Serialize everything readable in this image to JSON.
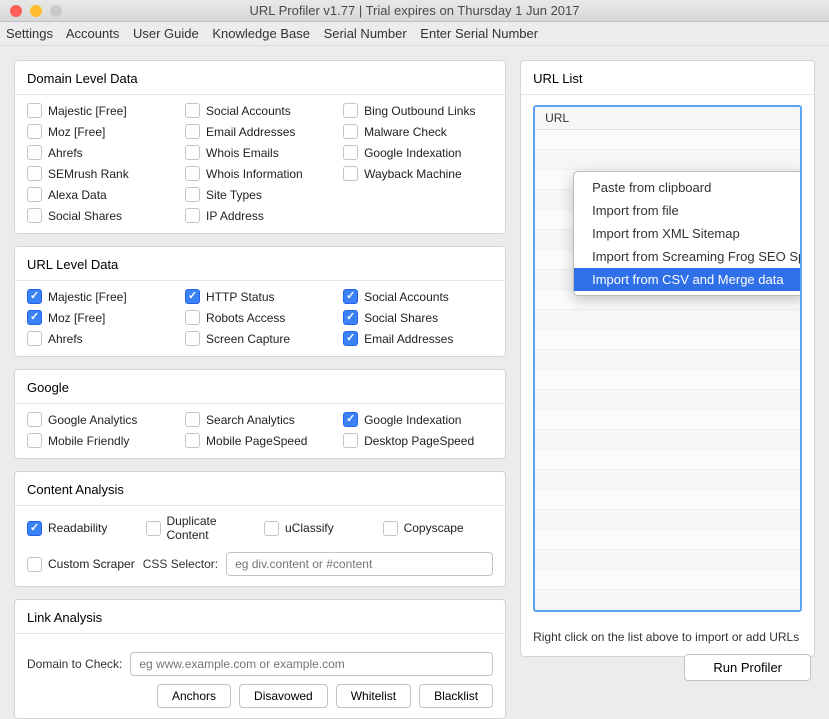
{
  "titlebar": {
    "title": "URL Profiler v1.77 | Trial expires on Thursday 1 Jun 2017"
  },
  "menubar": {
    "items": [
      "Settings",
      "Accounts",
      "User Guide",
      "Knowledge Base",
      "Serial Number",
      "Enter Serial Number"
    ]
  },
  "panels": {
    "domain": {
      "title": "Domain Level Data",
      "items": [
        {
          "label": "Majestic [Free]",
          "checked": false
        },
        {
          "label": "Social Accounts",
          "checked": false
        },
        {
          "label": "Bing Outbound Links",
          "checked": false
        },
        {
          "label": "Moz [Free]",
          "checked": false
        },
        {
          "label": "Email Addresses",
          "checked": false
        },
        {
          "label": "Malware Check",
          "checked": false
        },
        {
          "label": "Ahrefs",
          "checked": false
        },
        {
          "label": "Whois Emails",
          "checked": false
        },
        {
          "label": "Google Indexation",
          "checked": false
        },
        {
          "label": "SEMrush Rank",
          "checked": false
        },
        {
          "label": "Whois Information",
          "checked": false
        },
        {
          "label": "Wayback Machine",
          "checked": false
        },
        {
          "label": "Alexa Data",
          "checked": false
        },
        {
          "label": "Site Types",
          "checked": false
        },
        {
          "label": "",
          "checked": false,
          "empty": true
        },
        {
          "label": "Social Shares",
          "checked": false
        },
        {
          "label": "IP Address",
          "checked": false
        }
      ]
    },
    "url": {
      "title": "URL Level Data",
      "items": [
        {
          "label": "Majestic [Free]",
          "checked": true
        },
        {
          "label": "HTTP Status",
          "checked": true
        },
        {
          "label": "Social Accounts",
          "checked": true
        },
        {
          "label": "Moz [Free]",
          "checked": true
        },
        {
          "label": "Robots Access",
          "checked": false
        },
        {
          "label": "Social Shares",
          "checked": true
        },
        {
          "label": "Ahrefs",
          "checked": false
        },
        {
          "label": "Screen Capture",
          "checked": false
        },
        {
          "label": "Email Addresses",
          "checked": true
        }
      ]
    },
    "google": {
      "title": "Google",
      "items": [
        {
          "label": "Google Analytics",
          "checked": false
        },
        {
          "label": "Search Analytics",
          "checked": false
        },
        {
          "label": "Google Indexation",
          "checked": true
        },
        {
          "label": "Mobile Friendly",
          "checked": false
        },
        {
          "label": "Mobile PageSpeed",
          "checked": false
        },
        {
          "label": "Desktop PageSpeed",
          "checked": false
        }
      ]
    },
    "content": {
      "title": "Content Analysis",
      "items": [
        {
          "label": "Readability",
          "checked": true
        },
        {
          "label": "Duplicate Content",
          "checked": false
        },
        {
          "label": "uClassify",
          "checked": false
        },
        {
          "label": "Copyscape",
          "checked": false
        }
      ],
      "custom_scraper": {
        "label": "Custom Scraper",
        "checked": false
      },
      "css_selector_label": "CSS Selector:",
      "css_selector_placeholder": "eg div.content or #content"
    },
    "link": {
      "title": "Link Analysis",
      "domain_label": "Domain to Check:",
      "domain_placeholder": "eg www.example.com or example.com",
      "buttons": [
        "Anchors",
        "Disavowed",
        "Whitelist",
        "Blacklist"
      ]
    }
  },
  "url_list": {
    "title": "URL List",
    "column": "URL",
    "hint": "Right click on the list above to import or add URLs"
  },
  "context_menu": {
    "items": [
      {
        "label": "Paste from clipboard",
        "highlight": false
      },
      {
        "label": "Import from file",
        "highlight": false
      },
      {
        "label": "Import from XML Sitemap",
        "highlight": false
      },
      {
        "label": "Import from Screaming Frog SEO Spider",
        "highlight": false
      },
      {
        "label": "Import from CSV and Merge data",
        "highlight": true
      }
    ]
  },
  "run_button": "Run Profiler"
}
